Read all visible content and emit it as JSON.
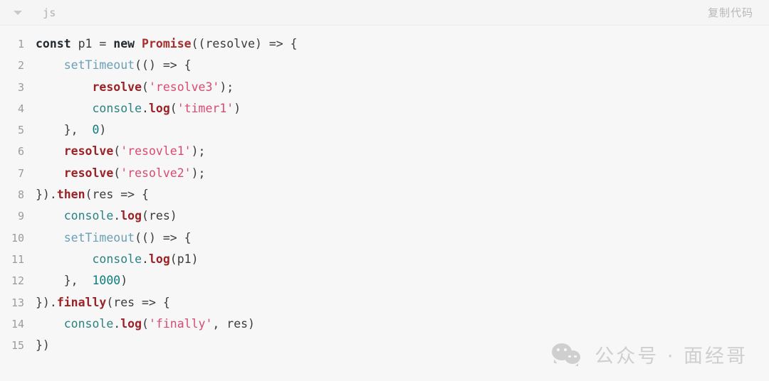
{
  "header": {
    "collapse_icon": "chevron-down-icon",
    "language": "js",
    "copy_label": "复制代码"
  },
  "code": {
    "language": "js",
    "line_count": 15,
    "lines": [
      {
        "number": "1",
        "tokens": [
          {
            "t": "const",
            "c": "keyword"
          },
          {
            "t": " ",
            "c": "plain"
          },
          {
            "t": "p1",
            "c": "plain"
          },
          {
            "t": " = ",
            "c": "plain"
          },
          {
            "t": "new",
            "c": "keyword"
          },
          {
            "t": " ",
            "c": "plain"
          },
          {
            "t": "Promise",
            "c": "class"
          },
          {
            "t": "((resolve) => {",
            "c": "punct"
          }
        ]
      },
      {
        "number": "2",
        "tokens": [
          {
            "t": "    ",
            "c": "plain"
          },
          {
            "t": "setTimeout",
            "c": "builtin"
          },
          {
            "t": "(() => {",
            "c": "punct"
          }
        ]
      },
      {
        "number": "3",
        "tokens": [
          {
            "t": "        ",
            "c": "plain"
          },
          {
            "t": "resolve",
            "c": "func"
          },
          {
            "t": "(",
            "c": "punct"
          },
          {
            "t": "'resolve3'",
            "c": "string"
          },
          {
            "t": ");",
            "c": "punct"
          }
        ]
      },
      {
        "number": "4",
        "tokens": [
          {
            "t": "        ",
            "c": "plain"
          },
          {
            "t": "console",
            "c": "object"
          },
          {
            "t": ".",
            "c": "punct"
          },
          {
            "t": "log",
            "c": "method"
          },
          {
            "t": "(",
            "c": "punct"
          },
          {
            "t": "'timer1'",
            "c": "string"
          },
          {
            "t": ")",
            "c": "punct"
          }
        ]
      },
      {
        "number": "5",
        "tokens": [
          {
            "t": "    },  ",
            "c": "punct"
          },
          {
            "t": "0",
            "c": "number"
          },
          {
            "t": ")",
            "c": "punct"
          }
        ]
      },
      {
        "number": "6",
        "tokens": [
          {
            "t": "    ",
            "c": "plain"
          },
          {
            "t": "resolve",
            "c": "func"
          },
          {
            "t": "(",
            "c": "punct"
          },
          {
            "t": "'resovle1'",
            "c": "string"
          },
          {
            "t": ");",
            "c": "punct"
          }
        ]
      },
      {
        "number": "7",
        "tokens": [
          {
            "t": "    ",
            "c": "plain"
          },
          {
            "t": "resolve",
            "c": "func"
          },
          {
            "t": "(",
            "c": "punct"
          },
          {
            "t": "'resolve2'",
            "c": "string"
          },
          {
            "t": ");",
            "c": "punct"
          }
        ]
      },
      {
        "number": "8",
        "tokens": [
          {
            "t": "}).",
            "c": "punct"
          },
          {
            "t": "then",
            "c": "method"
          },
          {
            "t": "(res => {",
            "c": "punct"
          }
        ]
      },
      {
        "number": "9",
        "tokens": [
          {
            "t": "    ",
            "c": "plain"
          },
          {
            "t": "console",
            "c": "object"
          },
          {
            "t": ".",
            "c": "punct"
          },
          {
            "t": "log",
            "c": "method"
          },
          {
            "t": "(res)",
            "c": "punct"
          }
        ]
      },
      {
        "number": "10",
        "tokens": [
          {
            "t": "    ",
            "c": "plain"
          },
          {
            "t": "setTimeout",
            "c": "builtin"
          },
          {
            "t": "(() => {",
            "c": "punct"
          }
        ]
      },
      {
        "number": "11",
        "tokens": [
          {
            "t": "        ",
            "c": "plain"
          },
          {
            "t": "console",
            "c": "object"
          },
          {
            "t": ".",
            "c": "punct"
          },
          {
            "t": "log",
            "c": "method"
          },
          {
            "t": "(p1)",
            "c": "punct"
          }
        ]
      },
      {
        "number": "12",
        "tokens": [
          {
            "t": "    },  ",
            "c": "punct"
          },
          {
            "t": "1000",
            "c": "number"
          },
          {
            "t": ")",
            "c": "punct"
          }
        ]
      },
      {
        "number": "13",
        "tokens": [
          {
            "t": "}).",
            "c": "punct"
          },
          {
            "t": "finally",
            "c": "method"
          },
          {
            "t": "(res => {",
            "c": "punct"
          }
        ]
      },
      {
        "number": "14",
        "tokens": [
          {
            "t": "    ",
            "c": "plain"
          },
          {
            "t": "console",
            "c": "object"
          },
          {
            "t": ".",
            "c": "punct"
          },
          {
            "t": "log",
            "c": "method"
          },
          {
            "t": "(",
            "c": "punct"
          },
          {
            "t": "'finally'",
            "c": "string"
          },
          {
            "t": ", res)",
            "c": "punct"
          }
        ]
      },
      {
        "number": "15",
        "tokens": [
          {
            "t": "})",
            "c": "punct"
          }
        ]
      }
    ]
  },
  "watermark": {
    "icon": "wechat-icon",
    "text": "公众号 · 面经哥"
  },
  "colors": {
    "card_background": "#f7f7f7",
    "header_background": "#f5f5f5",
    "line_number": "#9b9b9b",
    "keyword": "#24292e",
    "class": "#a52f2f",
    "function": "#9b2226",
    "builtin": "#6a9fb5",
    "object": "#2a8282",
    "string": "#d94a72",
    "number": "#0f7b7b",
    "plain": "#3b3b3b",
    "watermark": "#cfcfcf"
  }
}
